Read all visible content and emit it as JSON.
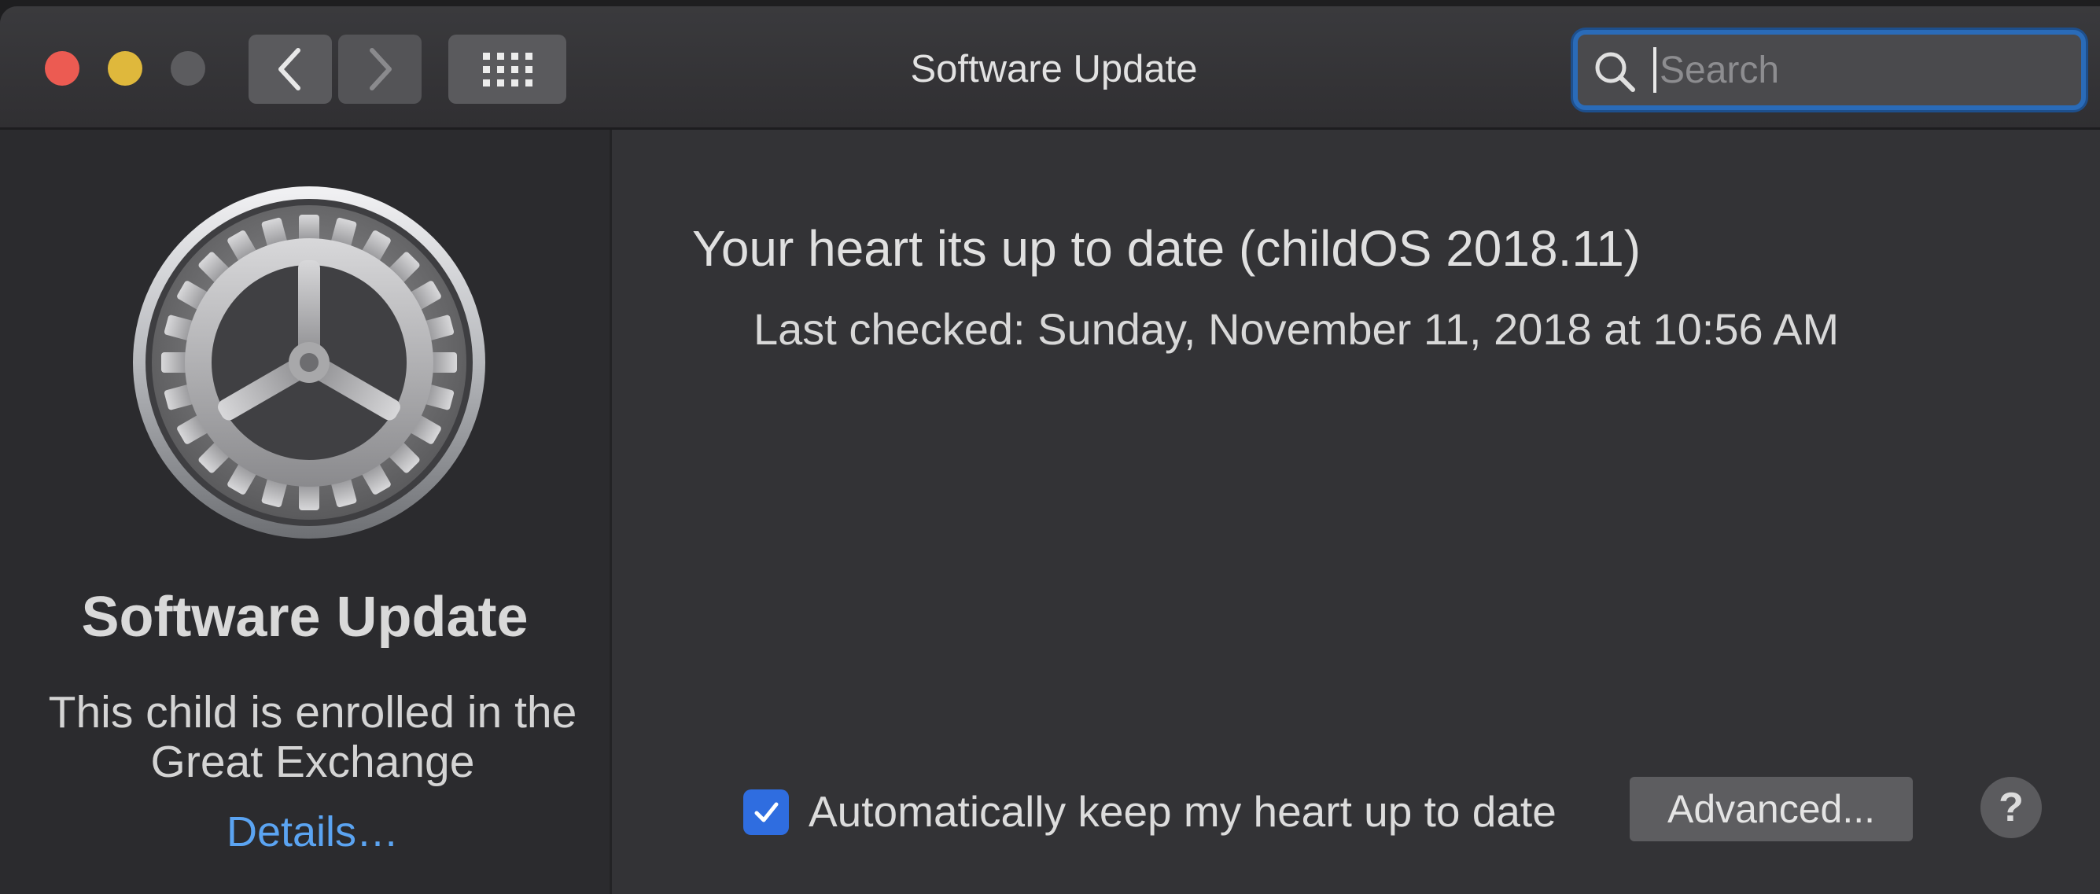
{
  "window": {
    "title": "Software Update",
    "traffic_lights": [
      {
        "name": "close",
        "color": "#ec5b52"
      },
      {
        "name": "minimize",
        "color": "#dfb83c"
      },
      {
        "name": "zoom",
        "color": "#5c5c5f"
      }
    ]
  },
  "toolbar": {
    "back_icon": "chevron-left-icon",
    "forward_icon": "chevron-right-icon",
    "grid_icon": "show-all-grid-icon"
  },
  "search": {
    "placeholder": "Search",
    "value": "",
    "icon": "search-icon",
    "focus_color": "#2a6bb8"
  },
  "sidebar": {
    "icon": "software-update-gear-icon",
    "title": "Software Update",
    "description": "This child  is enrolled in the Great Exchange",
    "details_link": "Details…",
    "link_color": "#5ba4f2"
  },
  "main": {
    "status": "Your heart its up to date (childOS 2018.11)",
    "last_checked": "Last checked: Sunday, November 11, 2018 at 10:56 AM",
    "auto_update": {
      "checked": true,
      "label": "Automatically keep my heart up to date"
    },
    "advanced_button": "Advanced...",
    "help_button": "?"
  }
}
